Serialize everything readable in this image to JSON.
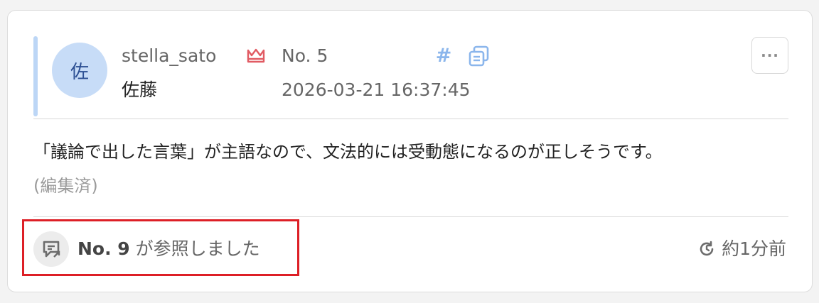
{
  "post": {
    "avatar_char": "佐",
    "username": "stella_sato",
    "post_number": "No. 5",
    "display_name": "佐藤",
    "timestamp": "2026-03-21 16:37:45",
    "body": "「議論で出した言葉」が主語なので、文法的には受動態になるのが正しそうです。",
    "edited_label": "(編集済)"
  },
  "icons": {
    "crown": "crown-icon",
    "hash": "hash-icon",
    "copy": "copy-icon",
    "more": "more-icon",
    "reference": "reply-reference-icon",
    "clock": "history-clock-icon"
  },
  "reference": {
    "number": "No. 9",
    "suffix": " が参照しました"
  },
  "time_ago": "約1分前",
  "colors": {
    "accent_bar": "#bcd6f6",
    "avatar_bg": "#c7dcf7",
    "crown": "#e15b63",
    "link_icon": "#8bb6ec",
    "highlight_box": "#dd1f26"
  }
}
